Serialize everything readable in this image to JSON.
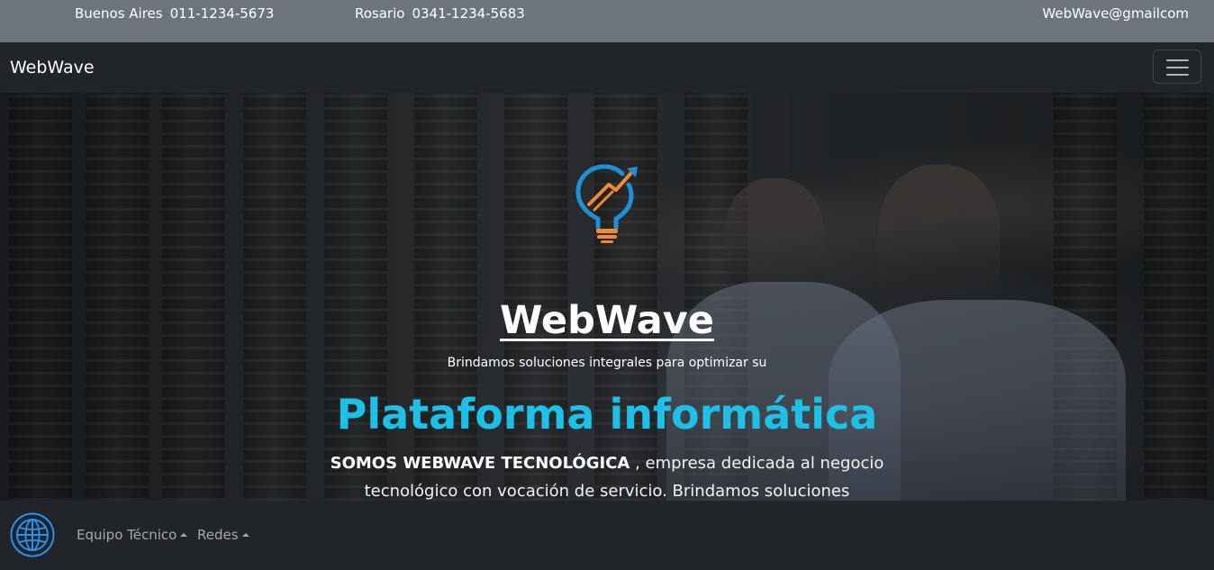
{
  "contact_bar": {
    "buenos_aires": {
      "city": "Buenos Aires",
      "phone": "011-1234-5673"
    },
    "rosario": {
      "city": "Rosario",
      "phone": "0341-1234-5683"
    },
    "email": "WebWave@gmailcom"
  },
  "navbar": {
    "brand": "WebWave",
    "toggler_icon": "hamburger-icon"
  },
  "hero": {
    "logo_icon": "lightbulb-growth-logo",
    "title": "WebWave",
    "subtitle": "Brindamos soluciones integrales para optimizar su",
    "heading": "Plataforma informática",
    "paragraph_strong": "SOMOS WEBWAVE TECNOLÓGICA",
    "paragraph_rest": " , empresa dedicada al negocio tecnológico con vocación de servicio. Brindamos soluciones integrales a",
    "heading_color": "#1fc0e6"
  },
  "bottom_nav": {
    "globe_icon": "globe-icon",
    "items": [
      {
        "label": "Equipo Técnico"
      },
      {
        "label": "Redes"
      }
    ]
  }
}
